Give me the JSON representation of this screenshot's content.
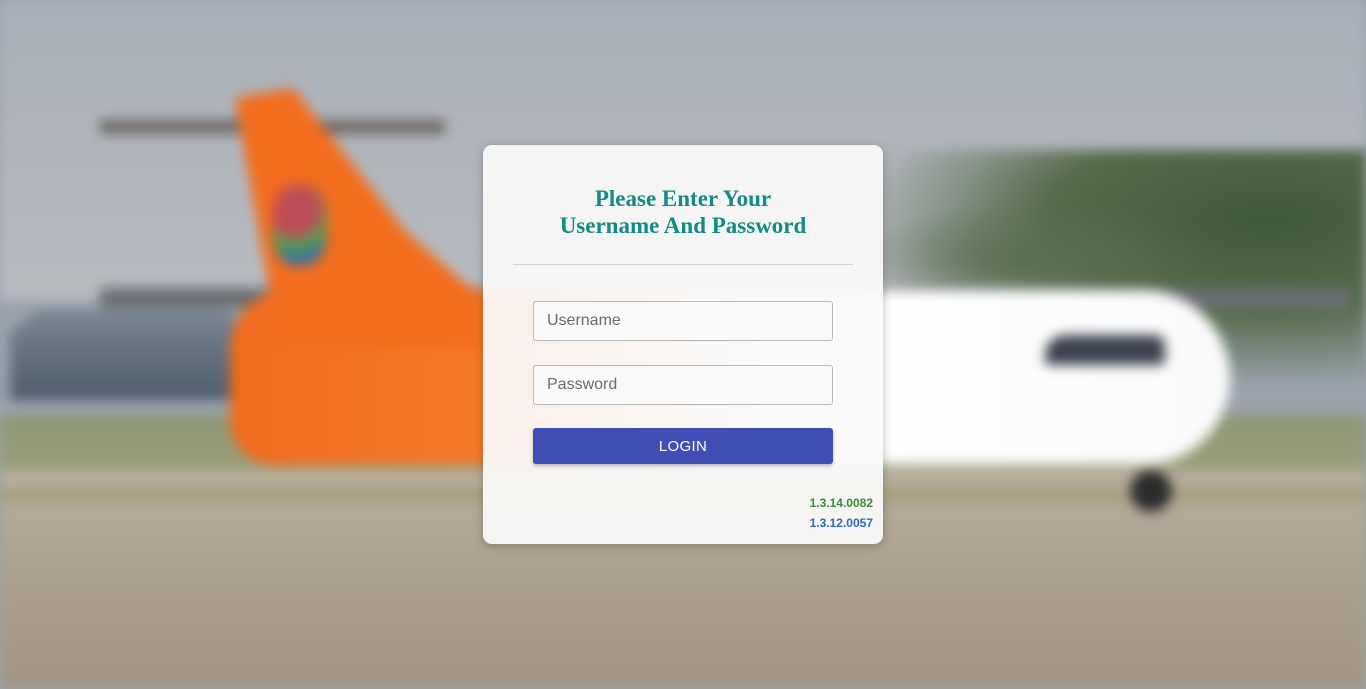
{
  "login": {
    "title_line1": "Please Enter Your",
    "title_line2": "Username And Password",
    "username_placeholder": "Username",
    "password_placeholder": "Password",
    "username_value": "",
    "password_value": "",
    "login_label": "LOGIN"
  },
  "versions": [
    {
      "text": "1.3.14.0082",
      "color": "#3a8a3a"
    },
    {
      "text": "1.3.12.0057",
      "color": "#2d6bbd"
    }
  ],
  "colors": {
    "title": "#138a83",
    "button": "#3f4db5"
  }
}
